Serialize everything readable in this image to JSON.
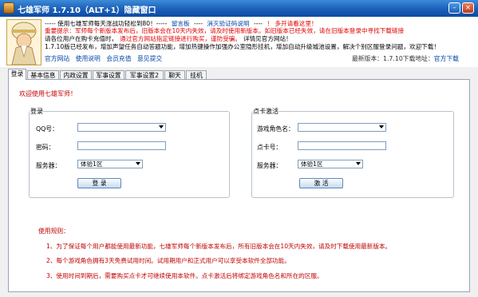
{
  "title_bar": {
    "title": "七雄军师 1.7.10（ALT+1）隐藏窗口"
  },
  "header": {
    "line1": [
      "----- 使用七雄军师每天涨战功轻松到80！-----",
      "留言板",
      "----",
      "消灭验证码说明",
      "----",
      "！ 多开请看这里！"
    ],
    "line2": "重要提示：军师每个新版本发布后，旧版本会在10天内失效，请及时使用新版本。如旧版本已经失效，请在旧版本登录中寻找下载链接",
    "line3": [
      "请各位用户在购卡充值时，",
      "通过官方网站指定链接进行购买，谨防受骗。",
      "详情见官方网站！"
    ],
    "line4": "1.7.10版已经发布，增加声望任务自动答题功能，增加热键操作加强办公室隐形挂机，增加自动升级城池设置，解决个别区服登录问题，欢迎下载！",
    "links": [
      "官方网站",
      "使用说明",
      "会员充值",
      "意见提交"
    ],
    "latest_version_label": "最新版本：",
    "latest_version": "1.7.10",
    "download_label": "下载地址：",
    "download_link": "官方下载"
  },
  "tabs": [
    "登录",
    "基本信息",
    "内政设置",
    "军事设置",
    "军事设置2",
    "聊天",
    "挂机"
  ],
  "welcome": "欢迎使用七雄军师！",
  "login": {
    "title": "登录",
    "qq_label": "QQ号：",
    "password_label": "密码：",
    "server_label": "服务器：",
    "server_value": "体验1区",
    "button": "登 录"
  },
  "card": {
    "title": "点卡激活",
    "role_label": "游戏角色名：",
    "card_label": "点卡号：",
    "server_label": "服务器：",
    "server_value": "体验1区",
    "button": "激 活"
  },
  "rules": {
    "title": "使用规则：",
    "items": [
      "1、为了保证每个用户都能使用最新功能，七雄军师每个新版本发布后，所有旧版本会在10天内失效，请及时下载使用最新版本。",
      "2、每个游戏角色拥有3天免费试用时间。试用期用户和正式用户可以享受本软件全部功能。",
      "3、使用时间到期后，需要购买点卡才可继续使用本软件。点卡激活后将绑定游戏角色名和所在的区服。"
    ]
  },
  "colors": {
    "titlebar": "#1b5fb8",
    "warning_red": "#e00000",
    "link_blue": "#0044aa"
  }
}
